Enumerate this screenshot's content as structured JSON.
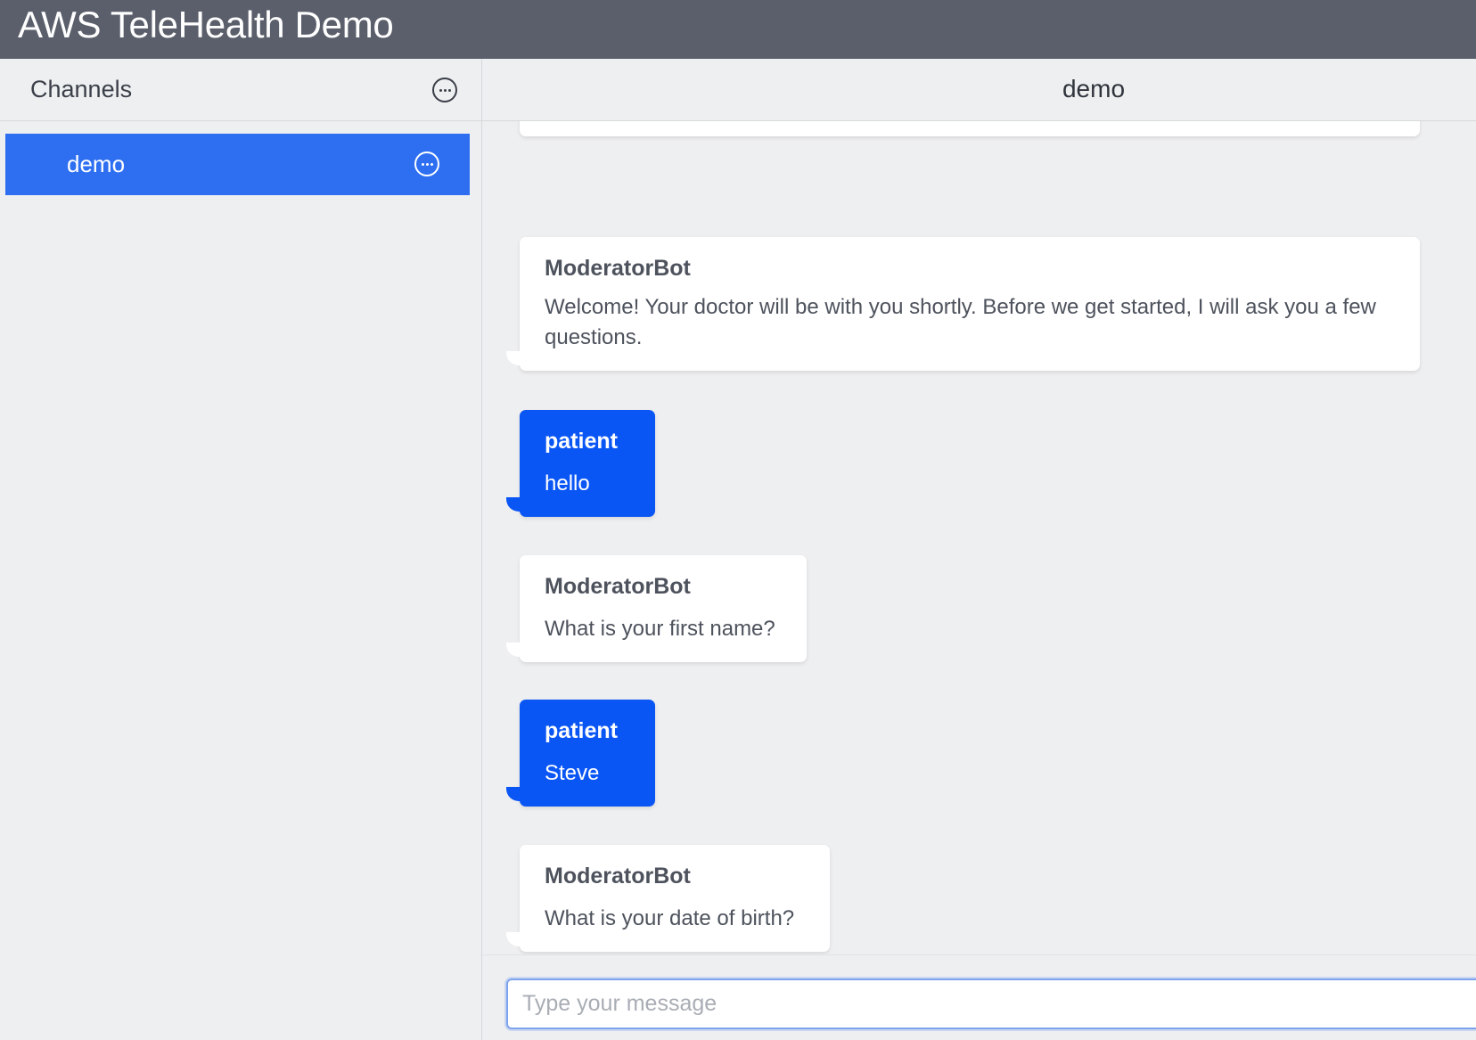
{
  "app": {
    "title": "AWS TeleHealth Demo"
  },
  "sidebar": {
    "title": "Channels",
    "channels": [
      {
        "label": "demo",
        "selected": true
      }
    ]
  },
  "chat": {
    "title": "demo",
    "messages": [
      {
        "sender": "ModeratorBot",
        "text": "Welcome! Your doctor will be with you shortly. Before we get started, I will ask you a few questions.",
        "type": "bot"
      },
      {
        "sender": "patient",
        "text": "hello",
        "type": "user"
      },
      {
        "sender": "ModeratorBot",
        "text": "What is your first name?",
        "type": "bot"
      },
      {
        "sender": "patient",
        "text": "Steve",
        "type": "user"
      },
      {
        "sender": "ModeratorBot",
        "text": "What is your date of birth?",
        "type": "bot"
      }
    ],
    "input": {
      "placeholder": "Type your message",
      "value": ""
    }
  },
  "colors": {
    "topbar": "#5a5f6b",
    "selected_channel": "#2e6ff2",
    "user_bubble": "#0a56f5",
    "bot_bubble": "#ffffff",
    "background": "#eeeff1"
  },
  "icons": {
    "more": "more-horizontal-circle-icon"
  }
}
